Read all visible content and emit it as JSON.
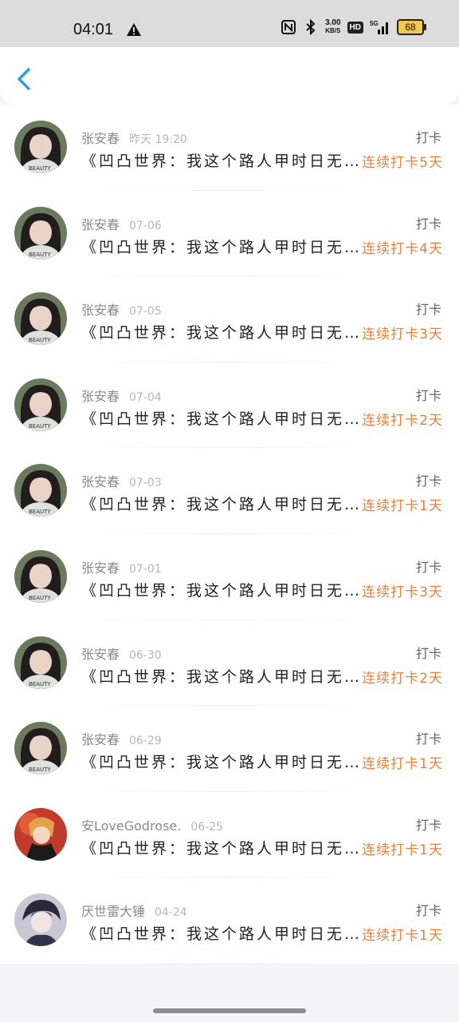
{
  "status": {
    "time": "04:01",
    "speed_top": "3.00",
    "speed_unit": "KB/S",
    "hd": "HD",
    "net": "5G",
    "battery": "68"
  },
  "rows": [
    {
      "name": "张安春",
      "time": "昨天 19:20",
      "type": "打卡",
      "title": "《凹凸世界：我这个路人甲时日无…",
      "streak": "连续打卡5天",
      "avatar": "girl"
    },
    {
      "name": "张安春",
      "time": "07-06",
      "type": "打卡",
      "title": "《凹凸世界：我这个路人甲时日无…",
      "streak": "连续打卡4天",
      "avatar": "girl"
    },
    {
      "name": "张安春",
      "time": "07-05",
      "type": "打卡",
      "title": "《凹凸世界：我这个路人甲时日无…",
      "streak": "连续打卡3天",
      "avatar": "girl"
    },
    {
      "name": "张安春",
      "time": "07-04",
      "type": "打卡",
      "title": "《凹凸世界：我这个路人甲时日无…",
      "streak": "连续打卡2天",
      "avatar": "girl"
    },
    {
      "name": "张安春",
      "time": "07-03",
      "type": "打卡",
      "title": "《凹凸世界：我这个路人甲时日无…",
      "streak": "连续打卡1天",
      "avatar": "girl"
    },
    {
      "name": "张安春",
      "time": "07-01",
      "type": "打卡",
      "title": "《凹凸世界：我这个路人甲时日无…",
      "streak": "连续打卡3天",
      "avatar": "girl"
    },
    {
      "name": "张安春",
      "time": "06-30",
      "type": "打卡",
      "title": "《凹凸世界：我这个路人甲时日无…",
      "streak": "连续打卡2天",
      "avatar": "girl"
    },
    {
      "name": "张安春",
      "time": "06-29",
      "type": "打卡",
      "title": "《凹凸世界：我这个路人甲时日无…",
      "streak": "连续打卡1天",
      "avatar": "girl"
    },
    {
      "name": "安LoveGodrose.",
      "time": "06-25",
      "type": "打卡",
      "title": "《凹凸世界：我这个路人甲时日无…",
      "streak": "连续打卡1天",
      "avatar": "anime-red"
    },
    {
      "name": "厌世雷大锤",
      "time": "04-24",
      "type": "打卡",
      "title": "《凹凸世界：我这个路人甲时日无…",
      "streak": "连续打卡1天",
      "avatar": "anime-dark"
    }
  ]
}
